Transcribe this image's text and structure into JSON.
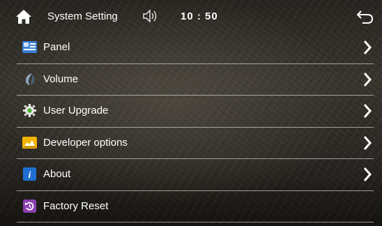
{
  "header": {
    "home_icon": "home-icon",
    "title": "System Setting",
    "speaker_icon": "speaker-icon",
    "time": "10 : 50",
    "back_icon": "back-arrow-icon"
  },
  "menu": {
    "items": [
      {
        "label": "Panel",
        "icon": "panel-icon",
        "has_arrow": true
      },
      {
        "label": "Volume",
        "icon": "volume-icon",
        "has_arrow": true
      },
      {
        "label": "User Upgrade",
        "icon": "gear-icon",
        "has_arrow": true
      },
      {
        "label": "Developer options",
        "icon": "developer-icon",
        "has_arrow": true
      },
      {
        "label": "About",
        "icon": "info-icon",
        "has_arrow": true
      },
      {
        "label": "Factory Reset",
        "icon": "reset-icon",
        "has_arrow": false
      }
    ]
  },
  "colors": {
    "text": "#ffffff",
    "divider": "#d9d9d9",
    "panel_icon": "#3b7fd6",
    "developer_icon": "#f0b400",
    "info_icon": "#1f6fd1",
    "reset_icon": "#8a3fb0"
  }
}
